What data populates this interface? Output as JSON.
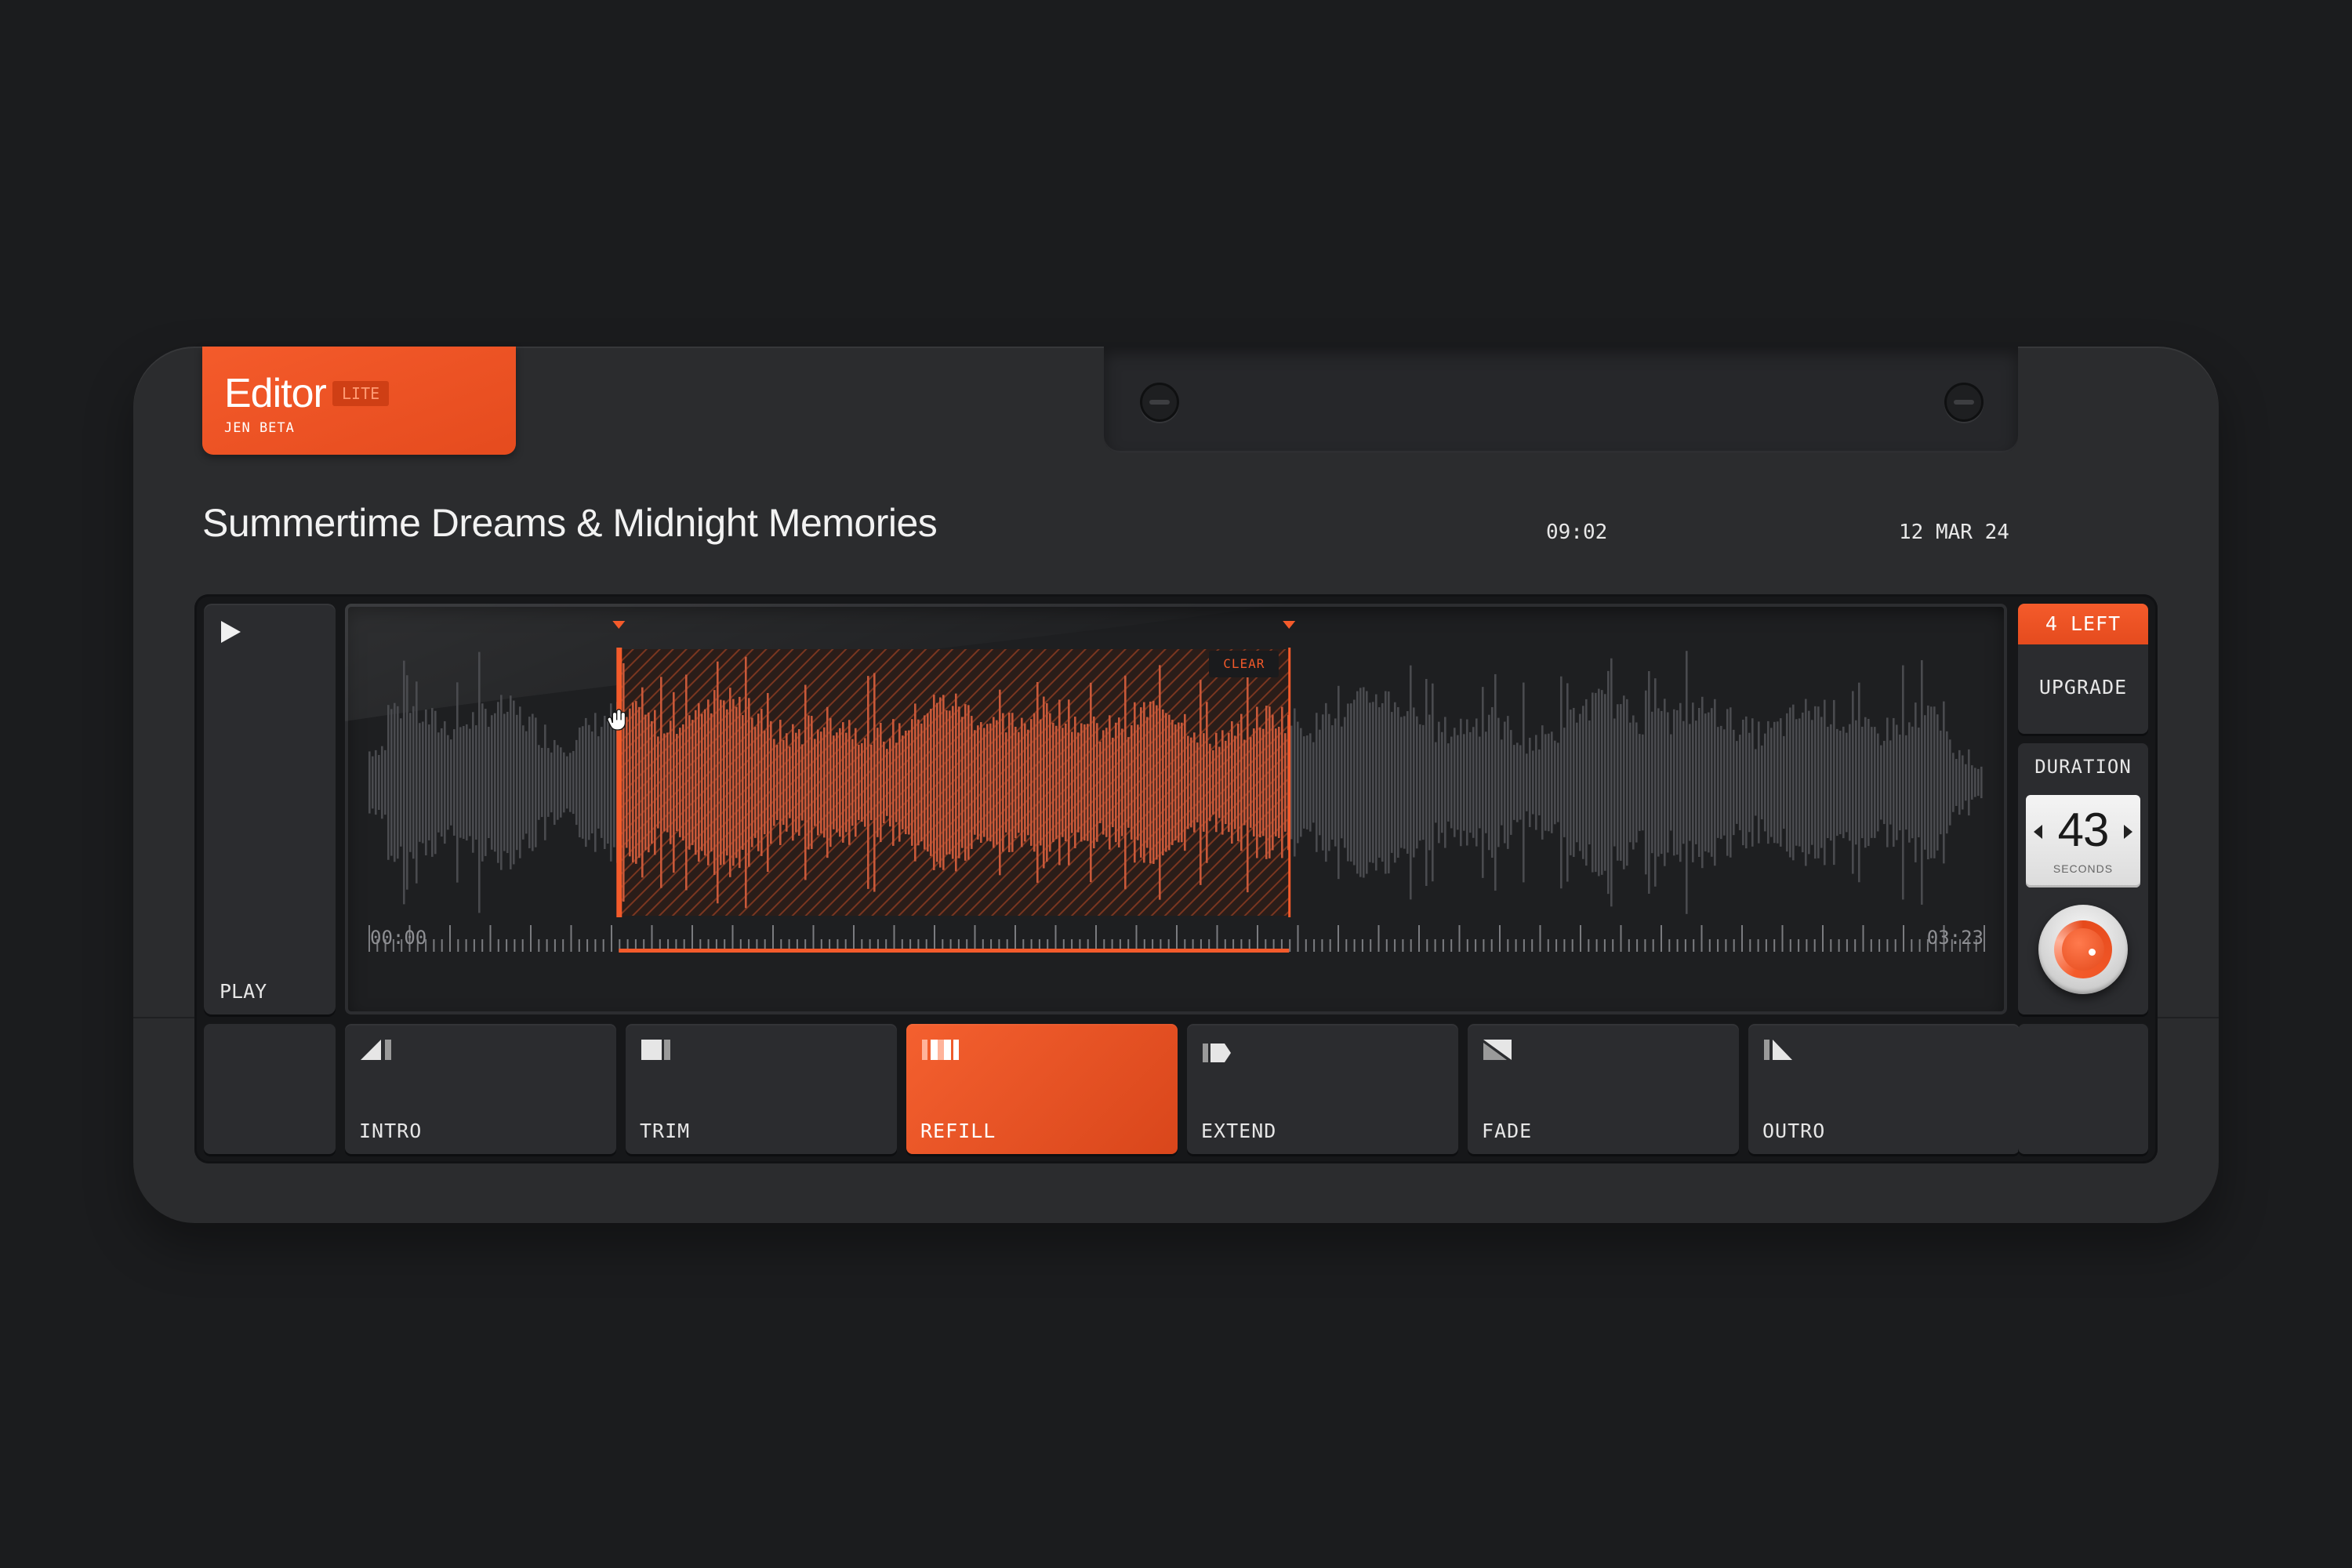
{
  "badge": {
    "title": "Editor",
    "tier": "LITE",
    "subtitle": "JEN BETA"
  },
  "track": {
    "title": "Summertime Dreams & Midnight Memories",
    "time": "09:02",
    "date": "12 MAR 24"
  },
  "player": {
    "play_label": "PLAY",
    "time_start": "00:00",
    "time_end": "03:23",
    "clear_label": "CLEAR",
    "selection": {
      "start_fraction": 0.155,
      "end_fraction": 0.57
    }
  },
  "credits": {
    "remaining_label": "4 LEFT",
    "upgrade_label": "UPGRADE"
  },
  "duration": {
    "label": "DURATION",
    "value": "43",
    "unit": "SECONDS"
  },
  "tools": {
    "intro": "INTRO",
    "trim": "TRIM",
    "refill": "REFILL",
    "extend": "EXTEND",
    "fade": "FADE",
    "outro": "OUTRO",
    "active": "refill"
  },
  "colors": {
    "accent": "#f45b2b",
    "background": "#1b1c1e",
    "device": "#2b2c2e",
    "waveform": "#4a4b4f",
    "waveform_selected": "#c9593a"
  }
}
